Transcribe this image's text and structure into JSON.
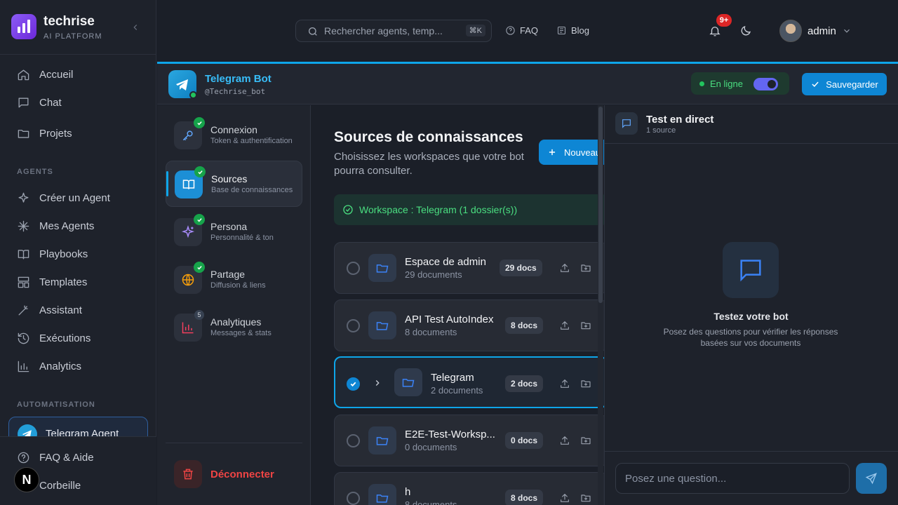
{
  "brand": {
    "name": "techrise",
    "sub": "AI PLATFORM"
  },
  "sidebar": {
    "main": [
      {
        "label": "Accueil",
        "icon": "home-icon"
      },
      {
        "label": "Chat",
        "icon": "chat-icon"
      },
      {
        "label": "Projets",
        "icon": "folder-icon"
      }
    ],
    "agents_title": "AGENTS",
    "agents": [
      {
        "label": "Créer un Agent",
        "icon": "sparkles-icon"
      },
      {
        "label": "Mes Agents",
        "icon": "asterisk-icon"
      },
      {
        "label": "Playbooks",
        "icon": "book-icon"
      },
      {
        "label": "Templates",
        "icon": "template-icon"
      },
      {
        "label": "Assistant",
        "icon": "wand-icon"
      },
      {
        "label": "Exécutions",
        "icon": "history-icon"
      },
      {
        "label": "Analytics",
        "icon": "chart-icon"
      }
    ],
    "automation_title": "AUTOMATISATION",
    "telegram_agent": "Telegram Agent",
    "footer": [
      {
        "label": "FAQ & Aide",
        "icon": "help-icon"
      },
      {
        "label": "Corbeille",
        "icon": "trash-icon"
      }
    ],
    "badge_letter": "N"
  },
  "header": {
    "search_placeholder": "Rechercher agents, temp...",
    "shortcut": "⌘K",
    "faq": "FAQ",
    "blog": "Blog",
    "notif_count": "9+",
    "user": "admin"
  },
  "bot": {
    "name": "Telegram Bot",
    "handle": "@Techrise_bot",
    "status": "En ligne",
    "save": "Sauvegarder"
  },
  "menu": [
    {
      "title": "Connexion",
      "sub": "Token & authentification",
      "icon": "key-icon",
      "badge": "check"
    },
    {
      "title": "Sources",
      "sub": "Base de connaissances",
      "icon": "book-open-icon",
      "badge": "check",
      "active": true
    },
    {
      "title": "Persona",
      "sub": "Personnalité & ton",
      "icon": "sparkles-icon",
      "badge": "check"
    },
    {
      "title": "Partage",
      "sub": "Diffusion & liens",
      "icon": "globe-icon",
      "badge": "check"
    },
    {
      "title": "Analytiques",
      "sub": "Messages & stats",
      "icon": "bar-chart-icon",
      "badge": "5"
    }
  ],
  "logout": "Déconnecter",
  "sources": {
    "title": "Sources de connaissances",
    "desc": "Choisissez les workspaces que votre bot pourra consulter.",
    "new_btn": "Nouveau",
    "workspace": "Workspace : Telegram (1 dossier(s))",
    "rows": [
      {
        "name": "Espace de admin",
        "count": "29 documents",
        "pill": "29 docs",
        "selected": false
      },
      {
        "name": "API Test AutoIndex",
        "count": "8 documents",
        "pill": "8 docs",
        "selected": false
      },
      {
        "name": "Telegram",
        "count": "2 documents",
        "pill": "2 docs",
        "selected": true
      },
      {
        "name": "E2E-Test-Worksp...",
        "count": "0 documents",
        "pill": "0 docs",
        "selected": false
      },
      {
        "name": "h",
        "count": "8 documents",
        "pill": "8 docs",
        "selected": false
      }
    ]
  },
  "chat": {
    "title": "Test en direct",
    "sub": "1 source",
    "empty_title": "Testez votre bot",
    "empty_desc": "Posez des questions pour vérifier les réponses basées sur vos documents",
    "placeholder": "Posez une question..."
  },
  "colors": {
    "accent": "#0ea5e9",
    "primary_btn": "#0e86d4",
    "success": "#22c55e",
    "danger": "#ef4444",
    "brand": "#7c3aed"
  }
}
